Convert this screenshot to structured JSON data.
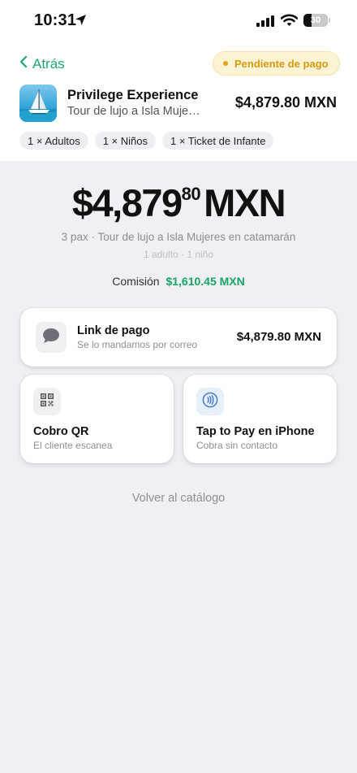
{
  "status_bar": {
    "time": "10:31",
    "battery": "30"
  },
  "header": {
    "back_label": "Atrás",
    "status_badge": "Pendiente de pago"
  },
  "product": {
    "name": "Privilege Experience",
    "subtitle": "Tour de lujo a Isla Mujeres en catamarán",
    "price": "$4,879.80 MXN",
    "chips": [
      "1 × Adultos",
      "1 × Niños",
      "1 × Ticket de Infante"
    ]
  },
  "total": {
    "whole": "$4,879",
    "cents": "80",
    "currency": "MXN",
    "summary": "3 pax · Tour de lujo a Isla Mujeres en catamarán",
    "summary_detail": "1 adulto · 1 niño",
    "commission_label": "Comisión",
    "commission_value": "$1,610.45 MXN"
  },
  "payment_options": {
    "link": {
      "title": "Link de pago",
      "subtitle": "Se lo mandamos por correo",
      "amount": "$4,879.80 MXN",
      "icon": "chat-bubble-icon"
    },
    "qr": {
      "title": "Cobro QR",
      "subtitle": "El cliente escanea",
      "icon": "qr-code-icon"
    },
    "tap": {
      "title": "Tap to Pay en iPhone",
      "subtitle": "Cobra sin contacto",
      "icon": "contactless-icon"
    }
  },
  "footer": {
    "back_to_catalog": "Volver al catálogo"
  },
  "colors": {
    "accent_green": "#1fa76b",
    "pending_text": "#d49b12",
    "pending_bg": "#fcf2d4",
    "background": "#efeff4",
    "contactless_blue": "#3a74c4"
  }
}
